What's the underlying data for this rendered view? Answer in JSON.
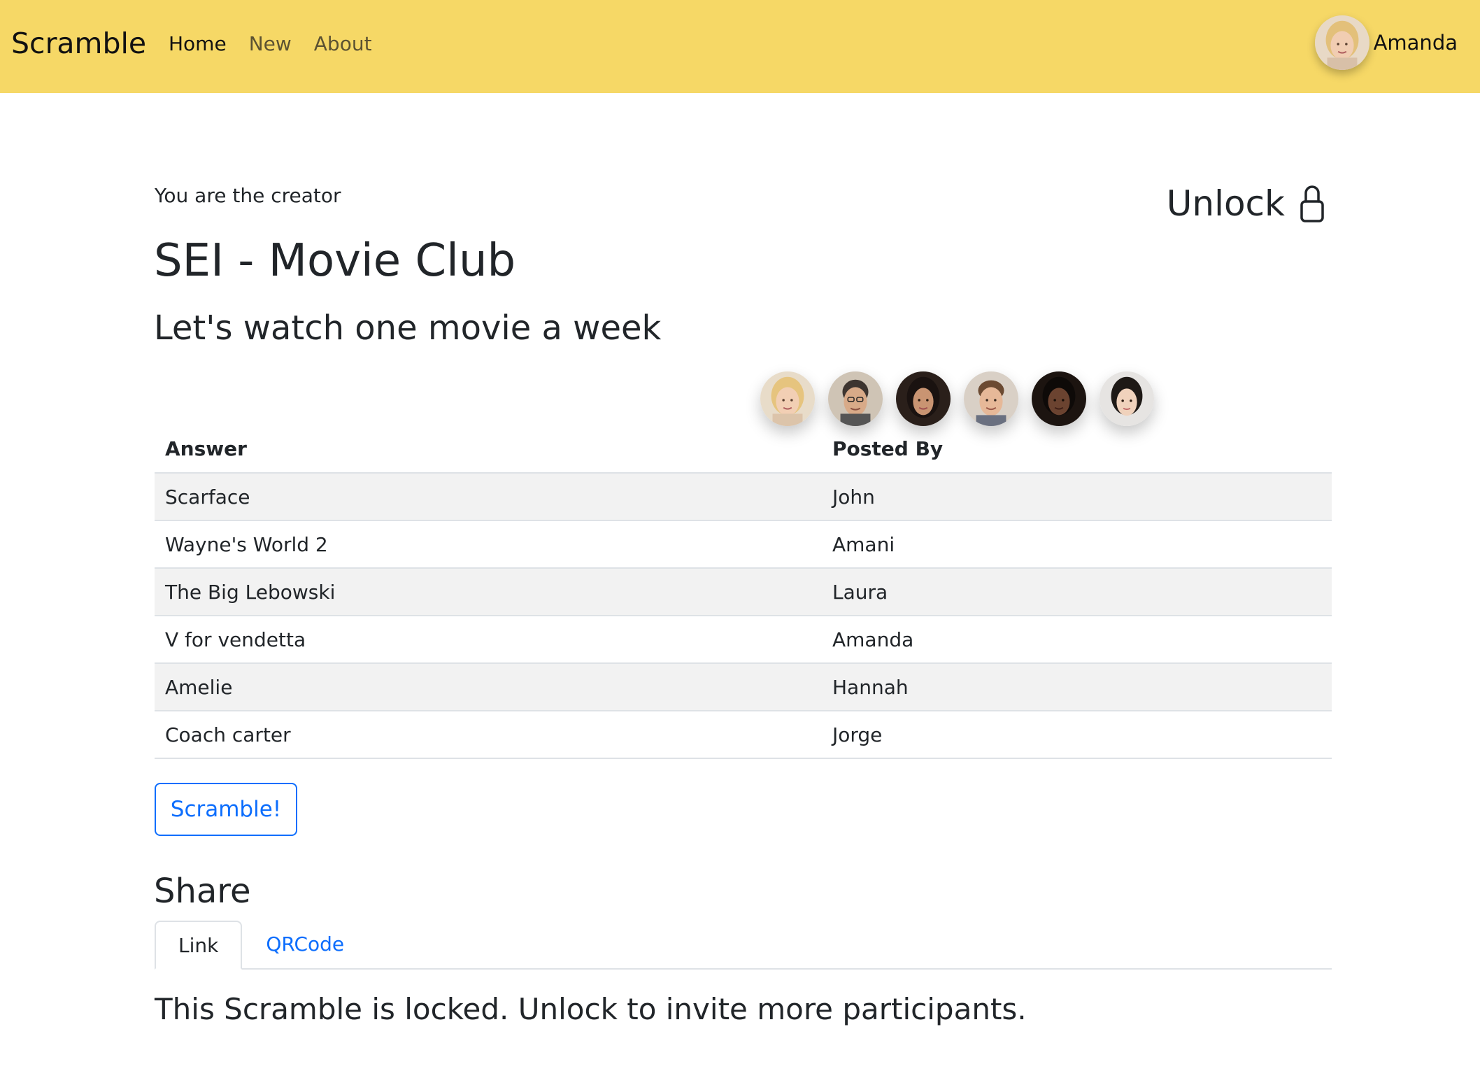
{
  "navbar": {
    "brand": "Scramble",
    "links": [
      {
        "label": "Home",
        "active": true
      },
      {
        "label": "New",
        "active": false
      },
      {
        "label": "About",
        "active": false
      }
    ],
    "user_name": "Amanda",
    "bg_color": "#f6d866"
  },
  "main": {
    "creator_note": "You are the creator",
    "unlock_label": "Unlock",
    "title": "SEI - Movie Club",
    "subtitle": "Let's watch one movie a week",
    "participant_avatars": [
      "avatar-amanda",
      "avatar-man-glasses",
      "avatar-woman-dark-hair",
      "avatar-man-brown-hair",
      "avatar-woman-dark-skin",
      "avatar-woman-asian"
    ]
  },
  "table": {
    "headers": [
      "Answer",
      "Posted By"
    ],
    "rows": [
      [
        "Scarface",
        "John"
      ],
      [
        "Wayne's World 2",
        "Amani"
      ],
      [
        "The Big Lebowski",
        "Laura"
      ],
      [
        "V for vendetta",
        "Amanda"
      ],
      [
        "Amelie",
        "Hannah"
      ],
      [
        "Coach carter",
        "Jorge"
      ]
    ]
  },
  "scramble_button": "Scramble!",
  "share": {
    "title": "Share",
    "tabs": [
      {
        "label": "Link",
        "active": true
      },
      {
        "label": "QRCode",
        "active": false
      }
    ],
    "message": "This Scramble is locked. Unlock to invite more participants."
  },
  "colors": {
    "accent": "#0d6efd",
    "stripe": "#f2f2f2",
    "border": "#dee2e6"
  }
}
